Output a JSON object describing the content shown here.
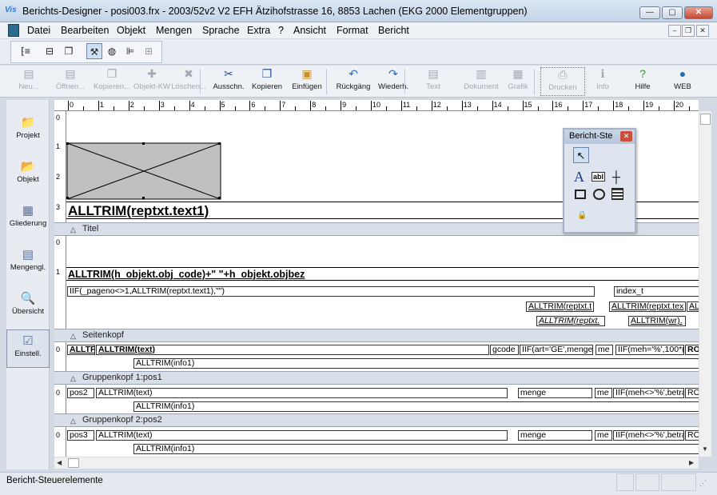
{
  "window": {
    "title": "Berichts-Designer - posi003.frx - 2003/52v2 V2 EFH Ätzihofstrasse 16, 8853 Lachen (EKG 2000 Elementgruppen)",
    "icon_text": "Vis"
  },
  "menu": [
    "Datei",
    "Bearbeiten",
    "Objekt",
    "Mengen",
    "Sprache",
    "Extra",
    "?",
    "Ansicht",
    "Format",
    "Bericht"
  ],
  "toolbar": [
    {
      "label": "Neu...",
      "icon": "new-icon",
      "enabled": false
    },
    {
      "label": "Öffnen...",
      "icon": "open-icon",
      "enabled": false
    },
    {
      "label": "Kopieren...",
      "icon": "copy-object-icon",
      "enabled": false
    },
    {
      "label": "Objekt-KW",
      "icon": "object-kw-icon",
      "enabled": false
    },
    {
      "label": "Löschen...",
      "icon": "delete-icon",
      "enabled": false
    },
    {
      "label": "Ausschn.",
      "icon": "cut-icon",
      "enabled": true
    },
    {
      "label": "Kopieren",
      "icon": "copy-icon",
      "enabled": true
    },
    {
      "label": "Einfügen",
      "icon": "paste-icon",
      "enabled": true
    },
    {
      "label": "Rückgäng",
      "icon": "undo-icon",
      "enabled": true
    },
    {
      "label": "Wiederh.",
      "icon": "redo-icon",
      "enabled": true
    },
    {
      "label": "Text",
      "icon": "text-doc-icon",
      "enabled": false
    },
    {
      "label": "Dokument",
      "icon": "document-icon",
      "enabled": false
    },
    {
      "label": "Grafik",
      "icon": "graphic-icon",
      "enabled": false
    },
    {
      "label": "Drucken",
      "icon": "print-icon",
      "enabled": false
    },
    {
      "label": "Info",
      "icon": "info-icon",
      "enabled": false
    },
    {
      "label": "Hilfe",
      "icon": "help-icon",
      "enabled": true
    },
    {
      "label": "WEB",
      "icon": "globe-icon",
      "enabled": true
    }
  ],
  "nav": [
    {
      "label": "Projekt",
      "icon": "project-icon"
    },
    {
      "label": "Objekt",
      "icon": "object-icon"
    },
    {
      "label": "Gliederung",
      "icon": "outline-icon"
    },
    {
      "label": "Mengengl.",
      "icon": "quantity-icon"
    },
    {
      "label": "Übersicht",
      "icon": "overview-icon"
    },
    {
      "label": "Einstell.",
      "icon": "settings-icon",
      "selected": true
    }
  ],
  "ruler": {
    "top": [
      "0",
      "1",
      "2",
      "3",
      "4",
      "5",
      "6",
      "7",
      "8",
      "9",
      "10",
      "11",
      "12",
      "13",
      "14",
      "15",
      "16",
      "17",
      "18",
      "19",
      "20"
    ]
  },
  "bands": [
    "Titel",
    "Seitenkopf",
    "Gruppenkopf 1:pos1",
    "Gruppenkopf 2:pos2"
  ],
  "title_section": {
    "rows": [
      "0",
      "1",
      "2",
      "3"
    ],
    "heading": "ALLTRIM(reptxt.text1)"
  },
  "page_header": {
    "rows": [
      "0",
      "1"
    ],
    "heading": "ALLTRIM(h_objekt.obj_code)+\" \"+h_objekt.objbez",
    "iif_field": "IIF(_pageno<>1,ALLTRIM(reptxt.text1),\"\")",
    "index_field": "index_t",
    "f1": "ALLTRIM(reptxt.t",
    "f2": "ALLTRIM(reptxt.tex",
    "f3": "ALL",
    "f4": "ALLTRIM(reptxt.",
    "f5": "ALLTRIM(wr)."
  },
  "group1": {
    "row": "0",
    "f1": "ALLTF",
    "f2": "ALLTRIM(text)",
    "f3": "gcode",
    "f4": "IIF(art='GE',menge,",
    "f5": "me",
    "f6": "IIF(meh='%',100*(",
    "f7": "RO",
    "info": "ALLTRIM(info1)"
  },
  "group2": {
    "row": "0",
    "f1": "pos2",
    "f2": "ALLTRIM(text)",
    "f3": "menge",
    "f4": "me",
    "f5": "IIF(meh<>'%',betra",
    "f6": "RO",
    "info": "ALLTRIM(info1)"
  },
  "group3": {
    "row": "0",
    "f1": "pos3",
    "f2": "ALLTRIM(text)",
    "f3": "menge",
    "f4": "me",
    "f5": "IIF(meh<>'%',betra",
    "f6": "RO",
    "info": "ALLTRIM(info1)"
  },
  "palette": {
    "title": "Bericht-Ste",
    "tools": [
      "pointer-icon",
      "label-tool-icon",
      "field-tool-icon",
      "line-tool-icon",
      "rectangle-tool-icon",
      "rounded-rect-tool-icon",
      "picture-tool-icon",
      "lock-icon"
    ],
    "label_glyph": "A",
    "field_glyph": "abl"
  },
  "status": {
    "text": "Bericht-Steuerelemente"
  }
}
